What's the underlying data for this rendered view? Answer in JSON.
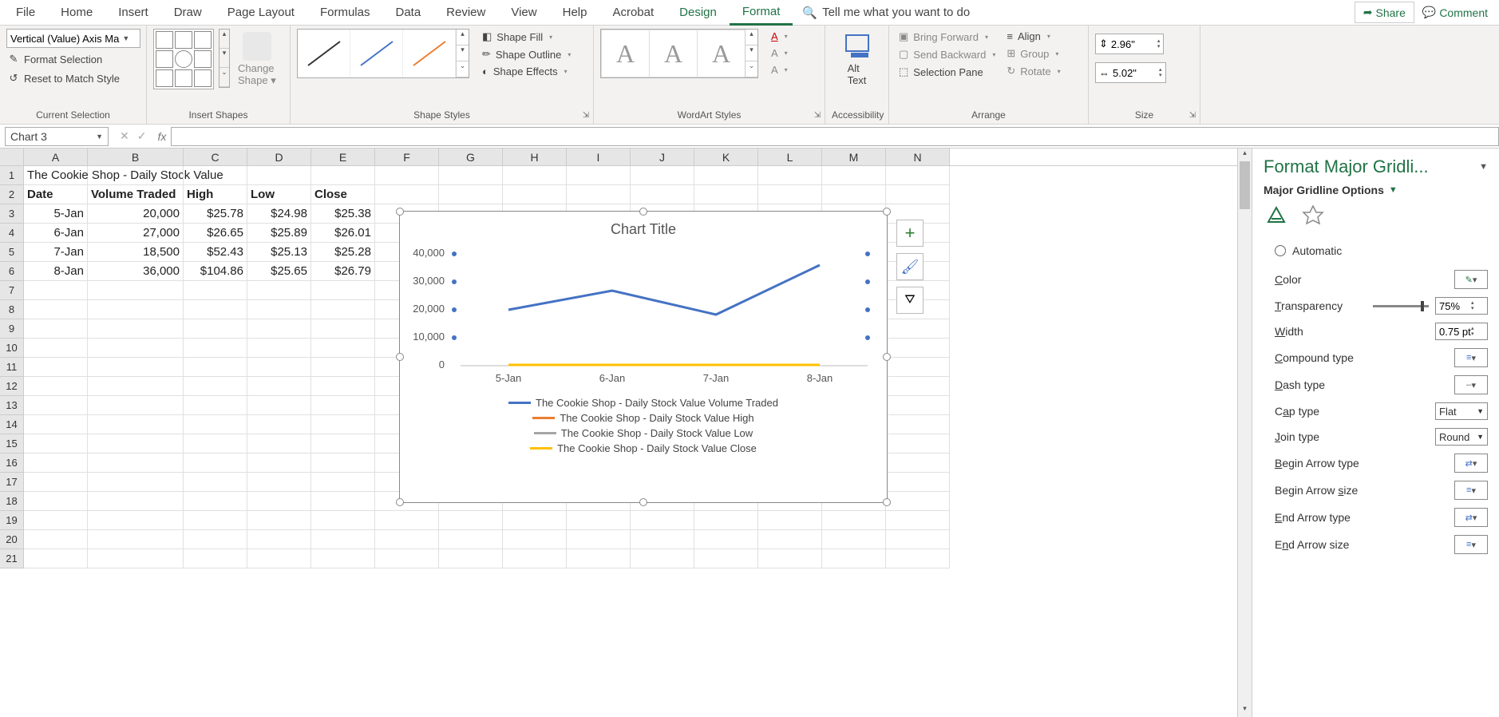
{
  "ribbon": {
    "tabs": [
      "File",
      "Home",
      "Insert",
      "Draw",
      "Page Layout",
      "Formulas",
      "Data",
      "Review",
      "View",
      "Help",
      "Acrobat",
      "Design",
      "Format"
    ],
    "active_tab": "Format",
    "tell_me": "Tell me what you want to do",
    "share": "Share",
    "comment": "Comment"
  },
  "groups": {
    "current_selection": {
      "label": "Current Selection",
      "element": "Vertical (Value) Axis Ma",
      "format_selection": "Format Selection",
      "reset_match": "Reset to Match Style"
    },
    "insert_shapes": {
      "label": "Insert Shapes",
      "change_shape": "Change Shape"
    },
    "shape_styles": {
      "label": "Shape Styles",
      "fill": "Shape Fill",
      "outline": "Shape Outline",
      "effects": "Shape Effects"
    },
    "wordart": {
      "label": "WordArt Styles"
    },
    "accessibility": {
      "label": "Accessibility",
      "alt_text": "Alt Text"
    },
    "arrange": {
      "label": "Arrange",
      "bring_forward": "Bring Forward",
      "send_backward": "Send Backward",
      "selection_pane": "Selection Pane",
      "align": "Align",
      "group": "Group",
      "rotate": "Rotate"
    },
    "size": {
      "label": "Size",
      "height": "2.96\"",
      "width": "5.02\""
    }
  },
  "name_box": "Chart 3",
  "sheet": {
    "columns": [
      "A",
      "B",
      "C",
      "D",
      "E",
      "F",
      "G",
      "H",
      "I",
      "J",
      "K",
      "L",
      "M",
      "N"
    ],
    "title": "The Cookie Shop - Daily Stock Value",
    "headers": [
      "Date",
      "Volume Traded",
      "High",
      "Low",
      "Close"
    ],
    "rows": [
      {
        "date": "5-Jan",
        "vol": "20,000",
        "high": "$25.78",
        "low": "$24.98",
        "close": "$25.38"
      },
      {
        "date": "6-Jan",
        "vol": "27,000",
        "high": "$26.65",
        "low": "$25.89",
        "close": "$26.01"
      },
      {
        "date": "7-Jan",
        "vol": "18,500",
        "high": "$52.43",
        "low": "$25.13",
        "close": "$25.28"
      },
      {
        "date": "8-Jan",
        "vol": "36,000",
        "high": "$104.86",
        "low": "$25.65",
        "close": "$26.79"
      }
    ]
  },
  "chart": {
    "title": "Chart Title",
    "y_ticks": [
      "40,000",
      "30,000",
      "20,000",
      "10,000",
      "0"
    ],
    "x_ticks": [
      "5-Jan",
      "6-Jan",
      "7-Jan",
      "8-Jan"
    ],
    "legend": [
      {
        "label": "The Cookie Shop - Daily Stock Value Volume Traded",
        "color": "#4472c4"
      },
      {
        "label": "The Cookie Shop - Daily Stock Value High",
        "color": "#ed7d31"
      },
      {
        "label": "The Cookie Shop - Daily Stock Value Low",
        "color": "#a5a5a5"
      },
      {
        "label": "The Cookie Shop - Daily Stock Value Close",
        "color": "#ffc000"
      }
    ]
  },
  "chart_data": {
    "type": "line",
    "title": "Chart Title",
    "categories": [
      "5-Jan",
      "6-Jan",
      "7-Jan",
      "8-Jan"
    ],
    "series": [
      {
        "name": "The Cookie Shop - Daily Stock Value Volume Traded",
        "values": [
          20000,
          27000,
          18500,
          36000
        ],
        "color": "#4472c4"
      },
      {
        "name": "The Cookie Shop - Daily Stock Value High",
        "values": [
          25.78,
          26.65,
          52.43,
          104.86
        ],
        "color": "#ed7d31"
      },
      {
        "name": "The Cookie Shop - Daily Stock Value Low",
        "values": [
          24.98,
          25.89,
          25.13,
          25.65
        ],
        "color": "#a5a5a5"
      },
      {
        "name": "The Cookie Shop - Daily Stock Value Close",
        "values": [
          25.38,
          26.01,
          25.28,
          26.79
        ],
        "color": "#ffc000"
      }
    ],
    "ylim": [
      0,
      40000
    ],
    "ylabel": "",
    "xlabel": ""
  },
  "pane": {
    "title": "Format Major Gridli...",
    "subtitle": "Major Gridline Options",
    "automatic": "Automatic",
    "color": "Color",
    "transparency": "Transparency",
    "transparency_val": "75%",
    "width": "Width",
    "width_val": "0.75 pt",
    "compound": "Compound type",
    "dash": "Dash type",
    "cap": "Cap type",
    "cap_val": "Flat",
    "join": "Join type",
    "join_val": "Round",
    "begin_arrow_type": "Begin Arrow type",
    "begin_arrow_size": "Begin Arrow size",
    "end_arrow_type": "End Arrow type",
    "end_arrow_size": "End Arrow size"
  }
}
